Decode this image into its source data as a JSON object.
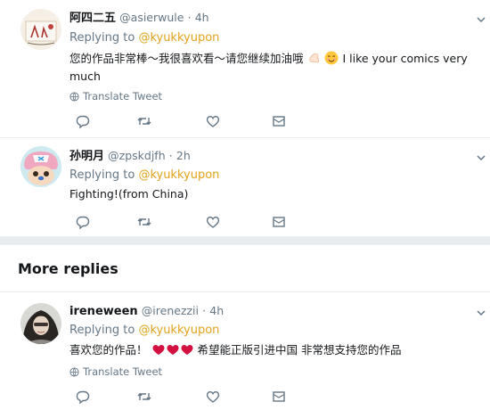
{
  "tweets": [
    {
      "name": "阿四二五",
      "handle": "@asierwule",
      "dot": "·",
      "time": "4h",
      "replying_prefix": "Replying to",
      "mention": "@kyukkyupon",
      "text_a": "您的作品非常棒～我很喜欢看～请您继续加油哦",
      "text_b": " I like your comics very much",
      "translate": "Translate Tweet"
    },
    {
      "name": "孙明月",
      "handle": "@zpskdjfh",
      "dot": "·",
      "time": "2h",
      "replying_prefix": "Replying to",
      "mention": "@kyukkyupon",
      "text_a": "Fighting!(from China)"
    },
    {
      "name": "ireneween",
      "handle": "@irenezzii",
      "dot": "·",
      "time": "4h",
      "replying_prefix": "Replying to",
      "mention": "@kyukkyupon",
      "text_a": "喜欢您的作品！",
      "text_b": "希望能正版引进中国 非常想支持您的作品",
      "translate": "Translate Tweet"
    }
  ],
  "section": {
    "more_replies": "More replies"
  },
  "colors": {
    "mention": "#e0a31b",
    "secondary": "#657786",
    "separator": "#e6ecf0",
    "heart": "#d3103f"
  },
  "icons": [
    "reply-icon",
    "retweet-icon",
    "like-icon",
    "message-icon",
    "globe-icon",
    "chevron-down-icon"
  ]
}
